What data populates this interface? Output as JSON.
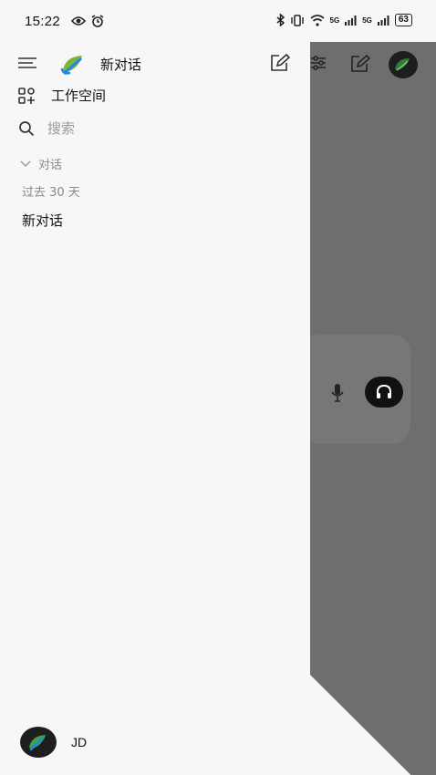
{
  "status_bar": {
    "time": "15:22",
    "network_1": "5G",
    "network_2": "5G",
    "battery": "63"
  },
  "drawer": {
    "header_title": "新对话",
    "workspace_label": "工作空间",
    "search_placeholder": "搜索",
    "section_label": "对话",
    "period_label": "过去 30 天",
    "conversations": [
      "新对话"
    ]
  },
  "user": {
    "name": "JD"
  },
  "icons": {
    "menu": "menu-icon",
    "logo": "leaf-logo-icon",
    "edit": "edit-icon",
    "workspace": "grid-plus-icon",
    "search": "search-icon",
    "chevron": "chevron-down-icon",
    "settings": "sliders-icon",
    "mic": "microphone-icon",
    "headset": "headphones-icon"
  },
  "colors": {
    "background": "#f7f7f7",
    "overlay": "#6e6e6e",
    "logo_green": "#7cb342",
    "logo_blue": "#1e88e5"
  }
}
